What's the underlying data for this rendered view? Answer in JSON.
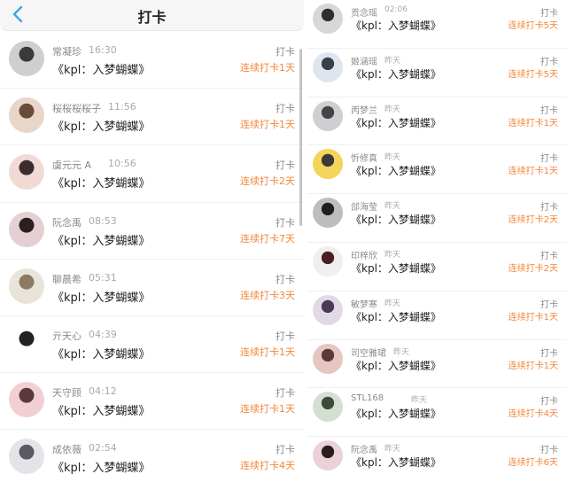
{
  "header": {
    "title": "打卡",
    "back_icon": "chevron-left-icon",
    "accent": "#3aa8e8"
  },
  "colors": {
    "streak": "#f0883c",
    "name": "#8a8a8a",
    "content": "#222222"
  },
  "left_list": [
    {
      "name": "常凝珍",
      "time": "16:30",
      "content": "《kpl：入梦蝴蝶》",
      "tag": "打卡",
      "streak": "连续打卡1天"
    },
    {
      "name": "桜桜桜桜子",
      "time": "11:56",
      "content": "《kpl：入梦蝴蝶》",
      "tag": "打卡",
      "streak": "连续打卡1天"
    },
    {
      "name": "虞元元 A",
      "time": "10:56",
      "content": "《kpl：入梦蝴蝶》",
      "tag": "打卡",
      "streak": "连续打卡2天"
    },
    {
      "name": "阮念禹",
      "time": "08:53",
      "content": "《kpl：入梦蝴蝶》",
      "tag": "打卡",
      "streak": "连续打卡7天"
    },
    {
      "name": "聊晨希",
      "time": "05:31",
      "content": "《kpl：入梦蝴蝶》",
      "tag": "打卡",
      "streak": "连续打卡3天"
    },
    {
      "name": "亓天心",
      "time": "04:39",
      "content": "《kpl：入梦蝴蝶》",
      "tag": "打卡",
      "streak": "连续打卡1天"
    },
    {
      "name": "天守顾",
      "time": "04:12",
      "content": "《kpl：入梦蝴蝶》",
      "tag": "打卡",
      "streak": "连续打卡1天"
    },
    {
      "name": "成依薇",
      "time": "02:54",
      "content": "《kpl：入梦蝴蝶》",
      "tag": "打卡",
      "streak": "连续打卡4天"
    }
  ],
  "right_list": [
    {
      "name": "贡念瑶",
      "time": "02:06",
      "content": "《kpl：入梦蝴蝶》",
      "tag": "打卡",
      "streak": "连续打卡5天"
    },
    {
      "name": "姬涵瑶",
      "time": "昨天",
      "content": "《kpl：入梦蝴蝶》",
      "tag": "打卡",
      "streak": "连续打卡5天"
    },
    {
      "name": "丙梦兰",
      "time": "昨天",
      "content": "《kpl：入梦蝴蝶》",
      "tag": "打卡",
      "streak": "连续打卡1天"
    },
    {
      "name": "忻修真",
      "time": "昨天",
      "content": "《kpl：入梦蝴蝶》",
      "tag": "打卡",
      "streak": "连续打卡1天"
    },
    {
      "name": "郃海莹",
      "time": "昨天",
      "content": "《kpl：入梦蝴蝶》",
      "tag": "打卡",
      "streak": "连续打卡2天"
    },
    {
      "name": "印梓欣",
      "time": "昨天",
      "content": "《kpl：入梦蝴蝶》",
      "tag": "打卡",
      "streak": "连续打卡2天"
    },
    {
      "name": "敏梦寒",
      "time": "昨天",
      "content": "《kpl：入梦蝴蝶》",
      "tag": "打卡",
      "streak": "连续打卡1天"
    },
    {
      "name": "司空雅珺",
      "time": "昨天",
      "content": "《kpl：入梦蝴蝶》",
      "tag": "打卡",
      "streak": "连续打卡1天"
    },
    {
      "name": "STL168",
      "time": "昨天",
      "content": "《kpl：入梦蝴蝶》",
      "tag": "打卡",
      "streak": "连续打卡4天"
    },
    {
      "name": "阮念禹",
      "time": "昨天",
      "content": "《kpl：入梦蝴蝶》",
      "tag": "打卡",
      "streak": "连续打卡6天"
    }
  ]
}
